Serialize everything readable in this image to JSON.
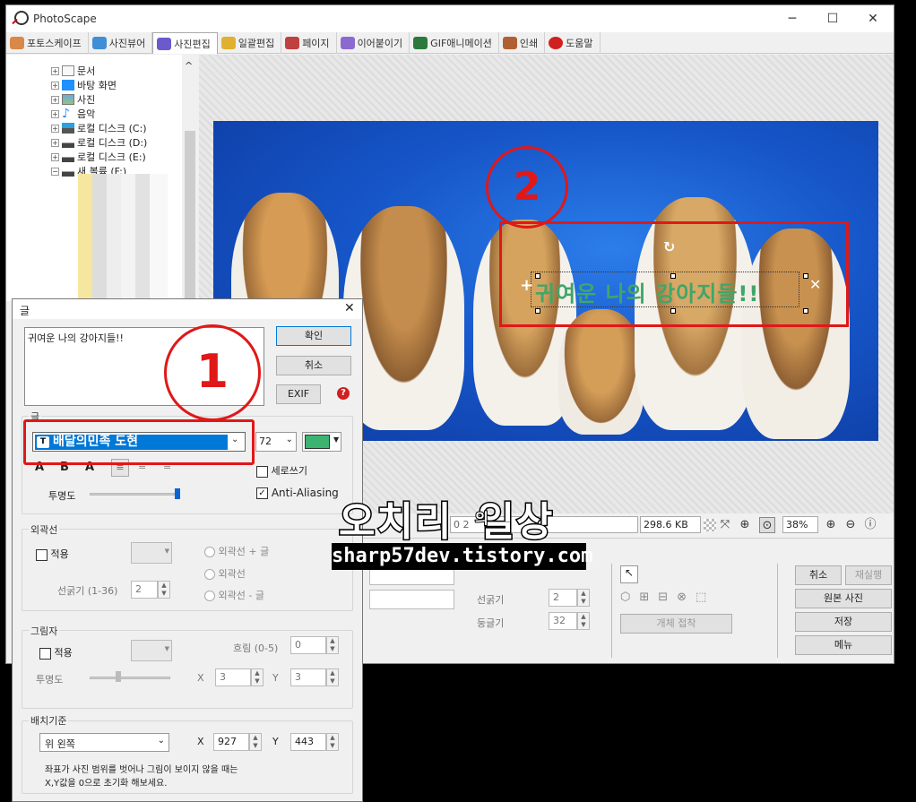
{
  "window": {
    "title": "PhotoScape",
    "controls": [
      "─",
      "☐",
      "✕"
    ]
  },
  "tabs": [
    {
      "label": "포토스케이프",
      "color": "#d9884a"
    },
    {
      "label": "사진뷰어",
      "color": "#3f8fd6"
    },
    {
      "label": "사진편집",
      "color": "#6a5acd"
    },
    {
      "label": "일괄편집",
      "color": "#e0b030"
    },
    {
      "label": "페이지",
      "color": "#c04040"
    },
    {
      "label": "이어붙이기",
      "color": "#8a6ad0"
    },
    {
      "label": "GIF애니메이션",
      "color": "#2b7a3b"
    },
    {
      "label": "인쇄",
      "color": "#b06030"
    },
    {
      "label": "도움말",
      "color": "#d02020"
    }
  ],
  "tree": {
    "items": [
      "문서",
      "바탕 화면",
      "사진",
      "음악",
      "로컬 디스크 (C:)",
      "로컬 디스크 (D:)",
      "로컬 디스크 (E:)",
      "새 볼륨 (F:)"
    ],
    "up_arrow": "^"
  },
  "photo": {
    "overlay_text": "귀여운 나의 강아지들!!",
    "marker_1": "1",
    "marker_2": "2"
  },
  "status": {
    "file_size": "298.6 KB",
    "zoom": "38%",
    "partial_left": "0 2"
  },
  "lower_panel": {
    "line_label": "선굵기",
    "line_value": "2",
    "round_label": "둥글기",
    "round_value": "32",
    "object_button": "개체 접착",
    "cancel": "취소",
    "redo": "재실행",
    "original": "원본 사진",
    "save": "저장",
    "menu": "메뉴"
  },
  "dialog": {
    "title": "글",
    "text_value": "귀여운 나의 강아지들!!",
    "ok": "확인",
    "cancel": "취소",
    "exif": "EXIF",
    "help_icon": "?",
    "font_group": "글",
    "font_name": "배달의민족 도현",
    "font_size": "72",
    "font_color": "#3cb371",
    "vertical_label": "세로쓰기",
    "vertical_checked": false,
    "antialias_label": "Anti-Aliasing",
    "antialias_checked": true,
    "opacity_label": "투명도",
    "opacity_value": 1.0,
    "outline_group": "외곽선",
    "outline_apply": "적용",
    "outline_opt1": "외곽선 + 글",
    "outline_opt2": "외곽선",
    "outline_opt3": "외곽선 - 글",
    "outline_width_label": "선굵기 (1-36)",
    "outline_width": "2",
    "shadow_group": "그림자",
    "shadow_apply": "적용",
    "shadow_blur_label": "흐림 (0-5)",
    "shadow_blur": "0",
    "shadow_opacity_label": "투명도",
    "shadow_x_label": "X",
    "shadow_x": "3",
    "shadow_y_label": "Y",
    "shadow_y": "3",
    "anchor_group": "배치기준",
    "anchor_value": "위 왼쪽",
    "x_label": "X",
    "x_value": "927",
    "y_label": "Y",
    "y_value": "443",
    "note_line1": "좌표가 사진 범위를 벗어나 그림이 보이지 않을 때는",
    "note_line2": "X,Y값을 0으로 초기화 해보세요."
  },
  "watermark": {
    "main": "오치리",
    "mid": "의",
    "main2": "일상",
    "url": "sharp57dev.tistory.com"
  }
}
